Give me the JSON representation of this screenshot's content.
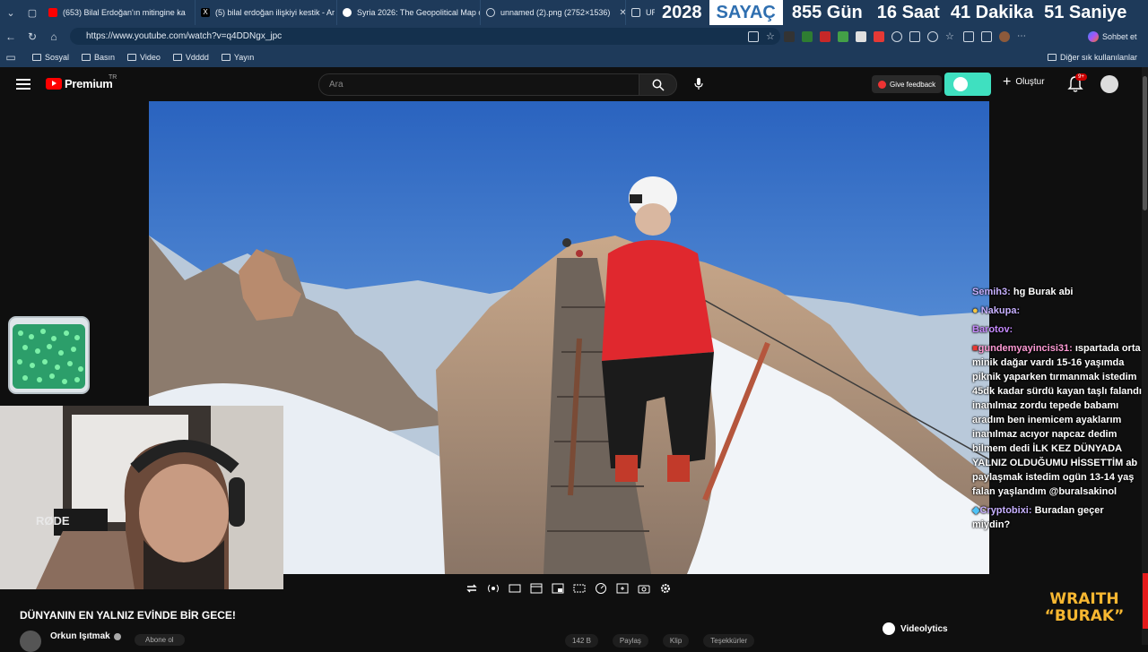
{
  "browser": {
    "tabs": [
      {
        "title": "(653) Bilal Erdoğan'ın mitingine ka",
        "icon": "youtube-icon",
        "color": "#ff0000"
      },
      {
        "title": "(5) bilal erdoğan ilişkiyi kestik - Ar",
        "icon": "x-icon",
        "color": "#ffffff"
      },
      {
        "title": "Syria 2026: The Geopolitical Map o",
        "icon": "globe-icon",
        "color": "#ffffff"
      },
      {
        "title": "unnamed (2).png (2752×1536)",
        "icon": "globe-icon",
        "color": "#cfd8e3"
      },
      {
        "title": "URL N",
        "icon": "link-icon",
        "color": "#cfd8e3"
      }
    ],
    "url": "https://www.youtube.com/watch?v=q4DDNgx_jpc",
    "chat_button": "Sohbet et",
    "bookmarks": [
      "Sosyal",
      "Basın",
      "Video",
      "Vdddd",
      "Yayın"
    ],
    "other_bookmarks": "Diğer sık kullanılanlar"
  },
  "counter": {
    "year": "2028",
    "label": "SAYAÇ",
    "days": "855 Gün",
    "hours": "16 Saat",
    "minutes": "41 Dakika",
    "seconds": "51 Saniye"
  },
  "youtube": {
    "brand": "Premium",
    "region": "TR",
    "search_placeholder": "Ara",
    "feedback": "Give feedback",
    "create": "Oluştur",
    "notif_count": "9+"
  },
  "chat": [
    {
      "name": "Semih3:",
      "text": "hg Burak abi"
    },
    {
      "name": "Nakupa:",
      "text": ""
    },
    {
      "name": "Barotov:",
      "text": ""
    },
    {
      "name": "gundemyayincisi31:",
      "text": "ıspartada orta minik dağar vardı 15-16 yaşımda piknik yaparken tırmanmak istedim 45dk kadar sürdü kayan taşlı falandı inanılmaz zordu tepede babamı aradım ben inemicem ayaklarım inanılmaz acıyor napcaz dedim bilmem dedi İLK KEZ DÜNYADA YALNIZ OLDUĞUMU HİSSETTİM ab paylaşmak istedim ogün 13-14 yaş falan yaşlandım @buralsakinol"
    },
    {
      "name": "Cryptobixi:",
      "text": "Buradan geçer miydin?"
    }
  ],
  "video": {
    "title": "DÜNYANIN EN YALNIZ EVİNDE BİR GECE!",
    "channel": "Orkun Işıtmak",
    "subscribe": "Abone ol",
    "likes": "142 B",
    "share": "Paylaş",
    "clip": "Klip",
    "thanks": "Teşekkürler"
  },
  "extensions": {
    "videolytics": "Videolytics"
  },
  "overlay": {
    "wraith_line1": "WRAITH",
    "wraith_line2": "“BURAK”"
  }
}
